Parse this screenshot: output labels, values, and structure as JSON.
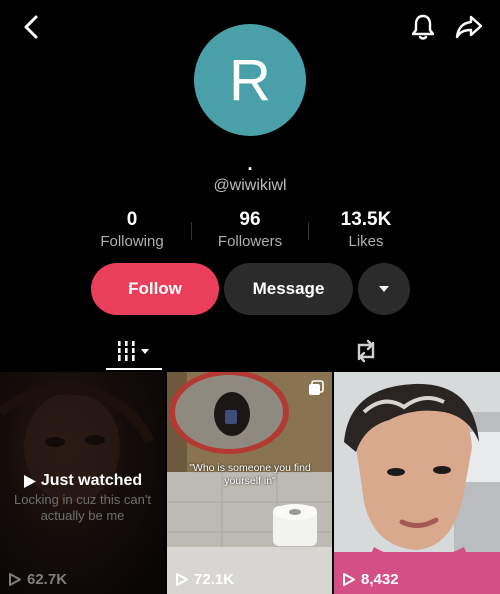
{
  "profile": {
    "avatar_letter": "R",
    "display_name": ".",
    "username": "@wiwikiwl"
  },
  "stats": [
    {
      "value": "0",
      "label": "Following"
    },
    {
      "value": "96",
      "label": "Followers"
    },
    {
      "value": "13.5K",
      "label": "Likes"
    }
  ],
  "actions": {
    "follow_label": "Follow",
    "message_label": "Message"
  },
  "icons": {
    "back": "chevron-left-icon",
    "notifications": "bell-icon",
    "share": "share-arrow-icon",
    "more": "caret-down-icon",
    "videos_tab": "grid-bars-icon",
    "reposts_tab": "repost-icon",
    "play": "play-icon"
  },
  "colors": {
    "avatar_bg": "#4aa0a9",
    "follow_bg": "#ea3f5b",
    "secondary_bg": "#2b2b2b"
  },
  "videos": [
    {
      "views": "62.7K",
      "overlay": "Just watched",
      "caption": "Locking in cuz this can't actually be me"
    },
    {
      "views": "72.1K",
      "caption": "\"Who is someone you find yourself in\""
    },
    {
      "views": "8,432"
    }
  ]
}
